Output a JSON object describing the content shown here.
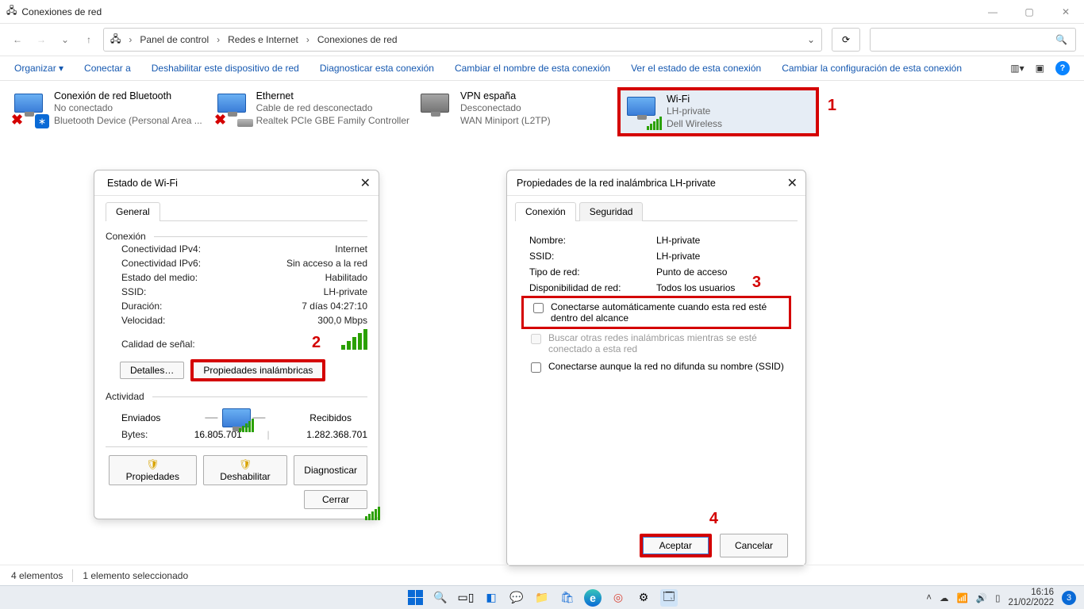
{
  "window": {
    "title": "Conexiones de red",
    "min": "—",
    "max": "▢",
    "close": "✕"
  },
  "navigation": {
    "crumb1": "Panel de control",
    "crumb2": "Redes e Internet",
    "crumb3": "Conexiones de red",
    "dropdown_glyph": "⌄",
    "reload_glyph": "⟳",
    "search_glyph": "🔍"
  },
  "toolbar": {
    "organizar": "Organizar ▾",
    "conectar": "Conectar a",
    "deshabilitar": "Deshabilitar este dispositivo de red",
    "diagnosticar": "Diagnosticar esta conexión",
    "cambiar_nombre": "Cambiar el nombre de esta conexión",
    "ver_estado": "Ver el estado de esta conexión",
    "cambiar_config": "Cambiar la configuración de esta conexión",
    "viewicons": "▥▾",
    "panel_toggle": "▣",
    "help": "?"
  },
  "connections": {
    "bt": {
      "title": "Conexión de red Bluetooth",
      "status": "No conectado",
      "device": "Bluetooth Device (Personal Area ...",
      "bt_glyph": "∗"
    },
    "eth": {
      "title": "Ethernet",
      "status": "Cable de red desconectado",
      "device": "Realtek PCIe GBE Family Controller"
    },
    "vpn": {
      "title": "VPN españa",
      "status": "Desconectado",
      "device": "WAN Miniport (L2TP)"
    },
    "wifi": {
      "title": "Wi-Fi",
      "ssid": "LH-private",
      "device": "Dell Wireless"
    }
  },
  "annot": {
    "n1": "1",
    "n2": "2",
    "n3": "3",
    "n4": "4"
  },
  "status_dialog": {
    "title": "Estado de Wi-Fi",
    "tab_general": "General",
    "grp_conexion": "Conexión",
    "ipv4_lbl": "Conectividad IPv4:",
    "ipv4_val": "Internet",
    "ipv6_lbl": "Conectividad IPv6:",
    "ipv6_val": "Sin acceso a la red",
    "medio_lbl": "Estado del medio:",
    "medio_val": "Habilitado",
    "ssid_lbl": "SSID:",
    "ssid_val": "LH-private",
    "dur_lbl": "Duración:",
    "dur_val": "7 días 04:27:10",
    "vel_lbl": "Velocidad:",
    "vel_val": "300,0 Mbps",
    "senal_lbl": "Calidad de señal:",
    "btn_detalles": "Detalles…",
    "btn_props_inalam": "Propiedades inalámbricas",
    "grp_actividad": "Actividad",
    "enviados": "Enviados",
    "recibidos": "Recibidos",
    "bytes_lbl": "Bytes:",
    "bytes_enviados": "16.805.701",
    "bytes_recibidos": "1.282.368.701",
    "btn_props": "Propiedades",
    "btn_deshab": "Deshabilitar",
    "btn_diag": "Diagnosticar",
    "btn_cerrar": "Cerrar",
    "dash": "—"
  },
  "props_dialog": {
    "title": "Propiedades de la red inalámbrica LH-private",
    "tab_conexion": "Conexión",
    "tab_seguridad": "Seguridad",
    "nombre_lbl": "Nombre:",
    "nombre_val": "LH-private",
    "ssid_lbl": "SSID:",
    "ssid_val": "LH-private",
    "tipo_lbl": "Tipo de red:",
    "tipo_val": "Punto de acceso",
    "disp_lbl": "Disponibilidad de red:",
    "disp_val": "Todos los usuarios",
    "cb1": "Conectarse automáticamente cuando esta red esté dentro del alcance",
    "cb2": "Buscar otras redes inalámbricas mientras se esté conectado a esta red",
    "cb3": "Conectarse aunque la red no difunda su nombre (SSID)",
    "btn_aceptar": "Aceptar",
    "btn_cancelar": "Cancelar"
  },
  "statusbar": {
    "count": "4 elementos",
    "selected": "1 elemento seleccionado"
  },
  "tray": {
    "chev": "˄",
    "cloud": "☁",
    "wifi": "📶",
    "vol": "🔊",
    "bat": "▯",
    "time": "16:16",
    "date": "21/02/2022",
    "notif": "3"
  },
  "taskbar_icons": {
    "search": "🔍",
    "tasks": "▭▯",
    "widgets": "◧",
    "chat": "💬",
    "files": "📁",
    "store": "🛍",
    "edge": "e",
    "chrome": "◎",
    "settings": "⚙",
    "netfolder": "🗔"
  }
}
